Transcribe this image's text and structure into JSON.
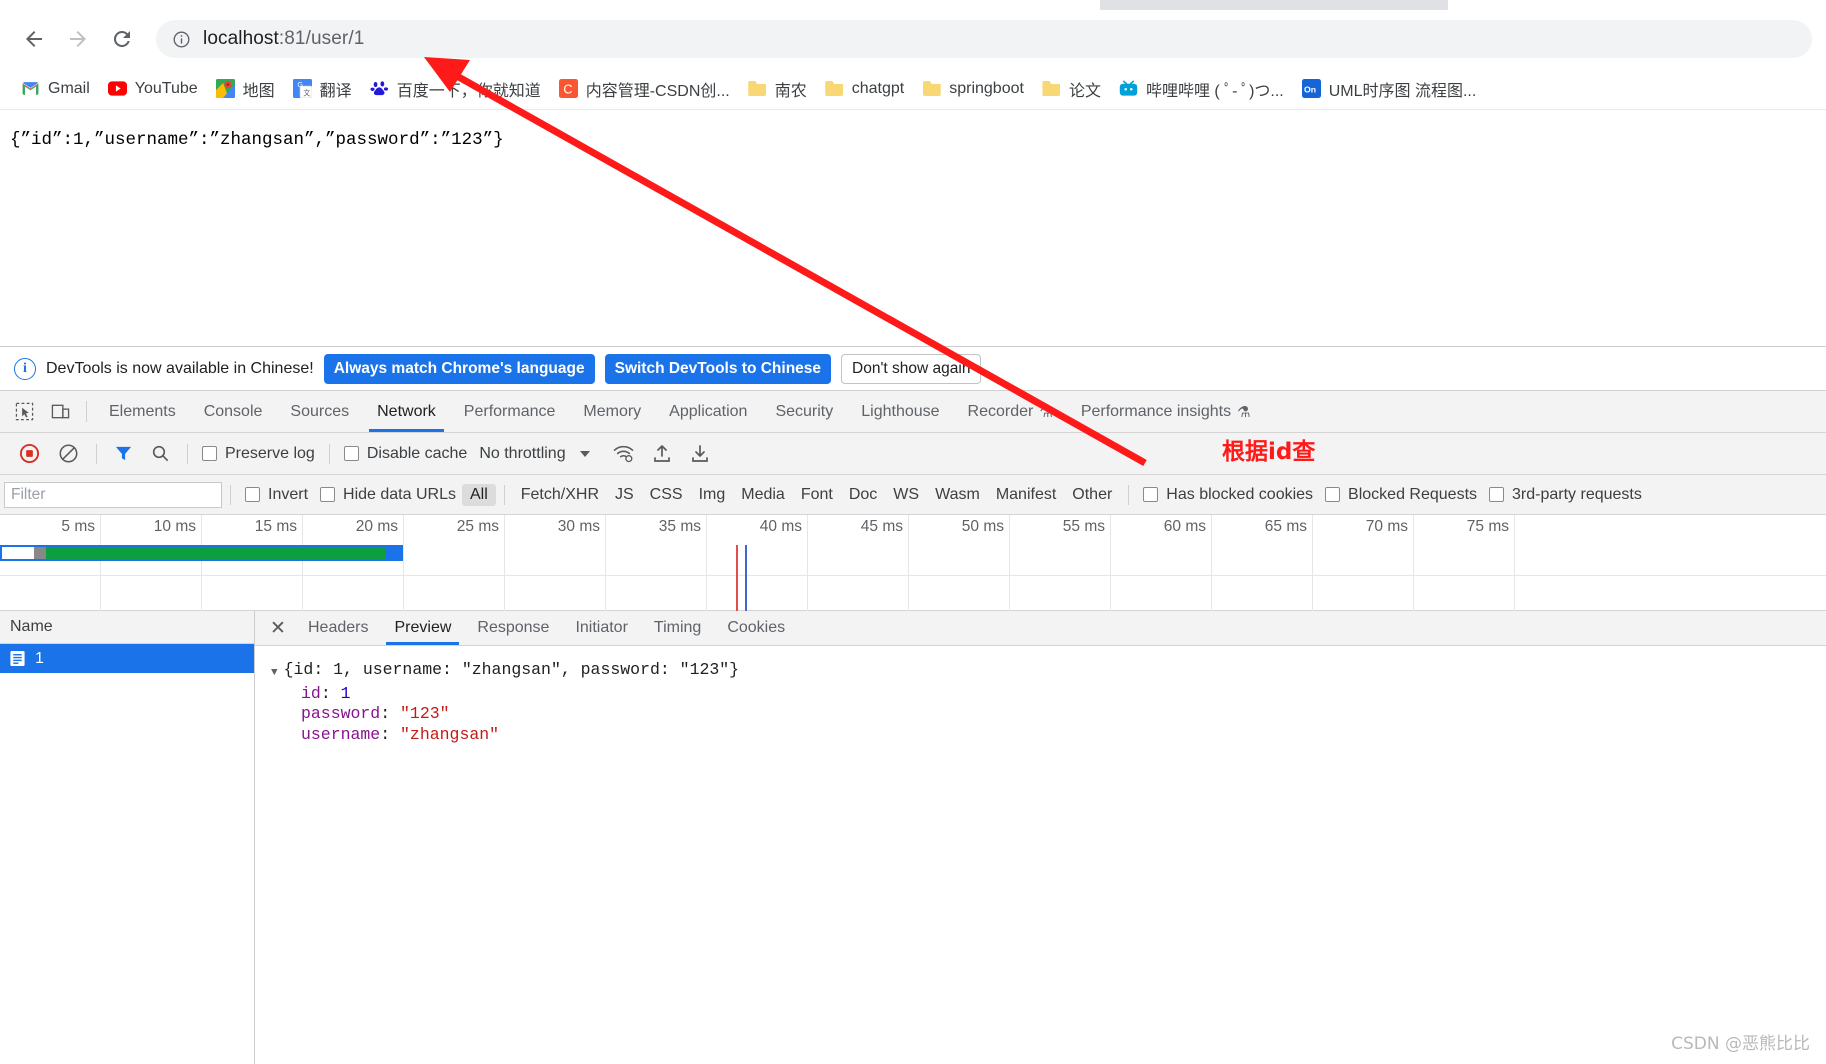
{
  "browser": {
    "nav": {
      "back_label": "Back",
      "forward_label": "Forward",
      "reload_label": "Reload"
    },
    "omnibox": {
      "site_info_icon": "info-circle-icon",
      "url_host": "localhost",
      "url_path": ":81/user/1",
      "full_url": "localhost:81/user/1"
    },
    "bookmarks": [
      {
        "label": "Gmail",
        "icon": "gmail-icon"
      },
      {
        "label": "YouTube",
        "icon": "youtube-icon"
      },
      {
        "label": "地图",
        "icon": "google-maps-icon"
      },
      {
        "label": "翻译",
        "icon": "google-translate-icon"
      },
      {
        "label": "百度一下，你就知道",
        "icon": "baidu-icon"
      },
      {
        "label": "内容管理-CSDN创...",
        "icon": "csdn-icon"
      },
      {
        "label": "南农",
        "icon": "folder-icon"
      },
      {
        "label": "chatgpt",
        "icon": "folder-icon"
      },
      {
        "label": "springboot",
        "icon": "folder-icon"
      },
      {
        "label": "论文",
        "icon": "folder-icon"
      },
      {
        "label": "哔哩哔哩 ( ﾟ- ﾟ)つ...",
        "icon": "bilibili-icon"
      },
      {
        "label": "UML时序图 流程图...",
        "icon": "on-icon"
      }
    ]
  },
  "page": {
    "json_response": "{”id”:1,”username”:”zhangsan”,”password”:”123”}"
  },
  "devtools": {
    "notice": {
      "text": "DevTools is now available in Chinese!",
      "info_icon": "info-circle-icon",
      "primary_button": "Always match Chrome's language",
      "secondary_button": "Switch DevTools to Chinese",
      "dismiss_button": "Don't show again"
    },
    "panel_tabs": [
      {
        "label": "Elements",
        "active": false,
        "flask": false
      },
      {
        "label": "Console",
        "active": false,
        "flask": false
      },
      {
        "label": "Sources",
        "active": false,
        "flask": false
      },
      {
        "label": "Network",
        "active": true,
        "flask": false
      },
      {
        "label": "Performance",
        "active": false,
        "flask": false
      },
      {
        "label": "Memory",
        "active": false,
        "flask": false
      },
      {
        "label": "Application",
        "active": false,
        "flask": false
      },
      {
        "label": "Security",
        "active": false,
        "flask": false
      },
      {
        "label": "Lighthouse",
        "active": false,
        "flask": false
      },
      {
        "label": "Recorder",
        "active": false,
        "flask": true
      },
      {
        "label": "Performance insights",
        "active": false,
        "flask": true
      }
    ],
    "toolbar": {
      "record_icon": "record-stop-icon",
      "clear_icon": "clear-icon",
      "filter_icon": "filter-funnel-icon",
      "search_icon": "search-icon",
      "preserve_log_label": "Preserve log",
      "preserve_log_checked": false,
      "disable_cache_label": "Disable cache",
      "disable_cache_checked": false,
      "throttling_value": "No throttling",
      "wifi_icon": "network-conditions-icon",
      "import_icon": "import-har-icon",
      "export_icon": "export-har-icon"
    },
    "filterbar": {
      "filter_placeholder": "Filter",
      "filter_value": "",
      "invert_label": "Invert",
      "invert_checked": false,
      "hide_data_urls_label": "Hide data URLs",
      "hide_data_urls_checked": false,
      "types": [
        "All",
        "Fetch/XHR",
        "JS",
        "CSS",
        "Img",
        "Media",
        "Font",
        "Doc",
        "WS",
        "Wasm",
        "Manifest",
        "Other"
      ],
      "selected_type": "All",
      "has_blocked_cookies_label": "Has blocked cookies",
      "has_blocked_cookies_checked": false,
      "blocked_requests_label": "Blocked Requests",
      "blocked_requests_checked": false,
      "third_party_label": "3rd-party requests",
      "third_party_checked": false
    },
    "timeline": {
      "ticks": [
        "5 ms",
        "10 ms",
        "15 ms",
        "20 ms",
        "25 ms",
        "30 ms",
        "35 ms",
        "40 ms",
        "45 ms",
        "50 ms",
        "55 ms",
        "60 ms",
        "65 ms",
        "70 ms",
        "75 ms"
      ],
      "bar_color": "#0d9e3f",
      "bar_outline_color": "#1a73e8"
    },
    "requests": {
      "column_header": "Name",
      "rows": [
        {
          "name": "1",
          "icon": "document-icon",
          "selected": true
        }
      ]
    },
    "detail": {
      "close_icon": "close-icon",
      "tabs": [
        {
          "label": "Headers",
          "active": false
        },
        {
          "label": "Preview",
          "active": true
        },
        {
          "label": "Response",
          "active": false
        },
        {
          "label": "Initiator",
          "active": false
        },
        {
          "label": "Timing",
          "active": false
        },
        {
          "label": "Cookies",
          "active": false
        }
      ],
      "preview": {
        "summary_prefix": "{id: 1, username: ",
        "summary": "{id: 1, username: \"zhangsan\", password: \"123\"}",
        "rows": [
          {
            "key": "id",
            "value": "1",
            "type": "number"
          },
          {
            "key": "password",
            "value": "\"123\"",
            "type": "string"
          },
          {
            "key": "username",
            "value": "\"zhangsan\"",
            "type": "string"
          }
        ]
      }
    }
  },
  "annotations": {
    "arrow_note": "根据id查",
    "arrow_color": "#ff1a1a",
    "watermark": "CSDN @恶熊比比"
  }
}
